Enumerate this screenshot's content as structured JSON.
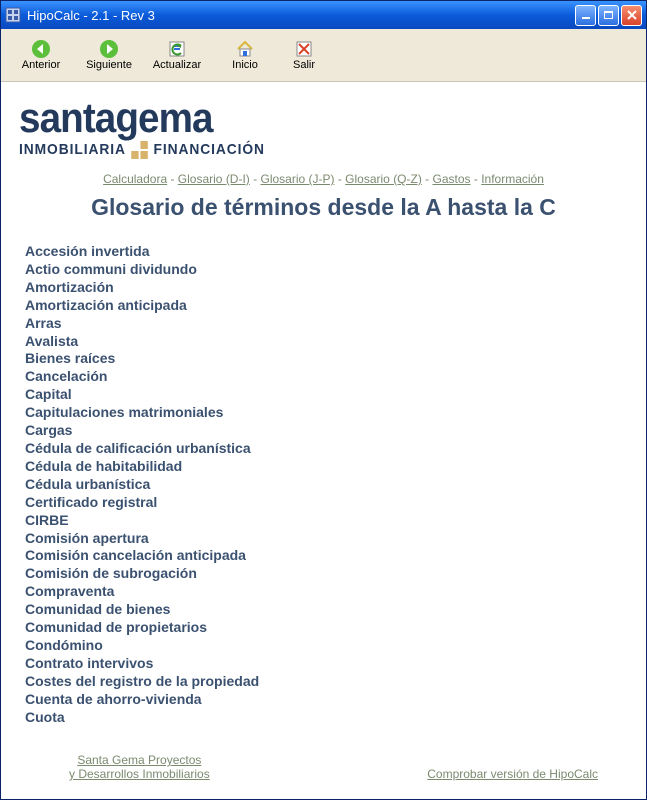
{
  "window": {
    "title": "HipoCalc - 2.1 - Rev 3"
  },
  "toolbar": {
    "back": "Anterior",
    "forward": "Siguiente",
    "reload": "Actualizar",
    "home": "Inicio",
    "exit": "Salir"
  },
  "logo": {
    "brand": "santagema",
    "sub_left": "INMOBILIARIA",
    "sub_right": "FINANCIACIÓN"
  },
  "nav": {
    "sep": " - ",
    "items": [
      "Calculadora",
      "Glosario (D-I)",
      "Glosario (J-P)",
      "Glosario (Q-Z)",
      "Gastos",
      "Información"
    ]
  },
  "heading": "Glosario de términos desde la A hasta la C",
  "terms": [
    "Accesión invertida",
    "Actio communi dividundo",
    "Amortización",
    "Amortización anticipada",
    "Arras",
    "Avalista",
    "Bienes raíces",
    "Cancelación",
    "Capital",
    "Capitulaciones matrimoniales",
    "Cargas",
    "Cédula de calificación urbanística",
    "Cédula de habitabilidad",
    "Cédula urbanística",
    "Certificado registral",
    "CIRBE",
    "Comisión apertura",
    "Comisión cancelación anticipada",
    "Comisión de subrogación",
    "Compraventa",
    "Comunidad de bienes",
    "Comunidad de propietarios",
    "Condómino",
    "Contrato intervivos",
    "Costes del registro de la propiedad",
    "Cuenta de ahorro-vivienda",
    "Cuota"
  ],
  "footer": {
    "left_line1": "Santa Gema Proyectos",
    "left_line2": "y Desarrollos Inmobiliarios",
    "right": "Comprobar versión de HipoCalc"
  }
}
